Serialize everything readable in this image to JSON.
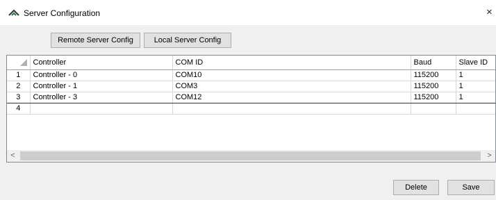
{
  "window": {
    "title": "Server Configuration",
    "close_glyph": "×"
  },
  "toolbar": {
    "remote_label": "Remote Server Config",
    "local_label": "Local Server Config"
  },
  "grid": {
    "columns": [
      "Controller",
      "COM ID",
      "Baud",
      "Slave ID"
    ],
    "rows": [
      {
        "num": "1",
        "controller": "Controller - 0",
        "com": "COM10",
        "baud": "115200",
        "slave": "1"
      },
      {
        "num": "2",
        "controller": "Controller - 1",
        "com": "COM3",
        "baud": "115200",
        "slave": "1"
      },
      {
        "num": "3",
        "controller": "Controller - 3",
        "com": "COM12",
        "baud": "115200",
        "slave": "1"
      },
      {
        "num": "4",
        "controller": "",
        "com": "",
        "baud": "",
        "slave": ""
      }
    ]
  },
  "scrollbar": {
    "left_arrow": "<",
    "right_arrow": ">"
  },
  "footer": {
    "delete_label": "Delete",
    "save_label": "Save"
  },
  "colors": {
    "accent": "#1a7a3a",
    "icon_dark": "#333333"
  },
  "icons": {
    "app": "app-logo-icon",
    "close": "close-icon"
  }
}
